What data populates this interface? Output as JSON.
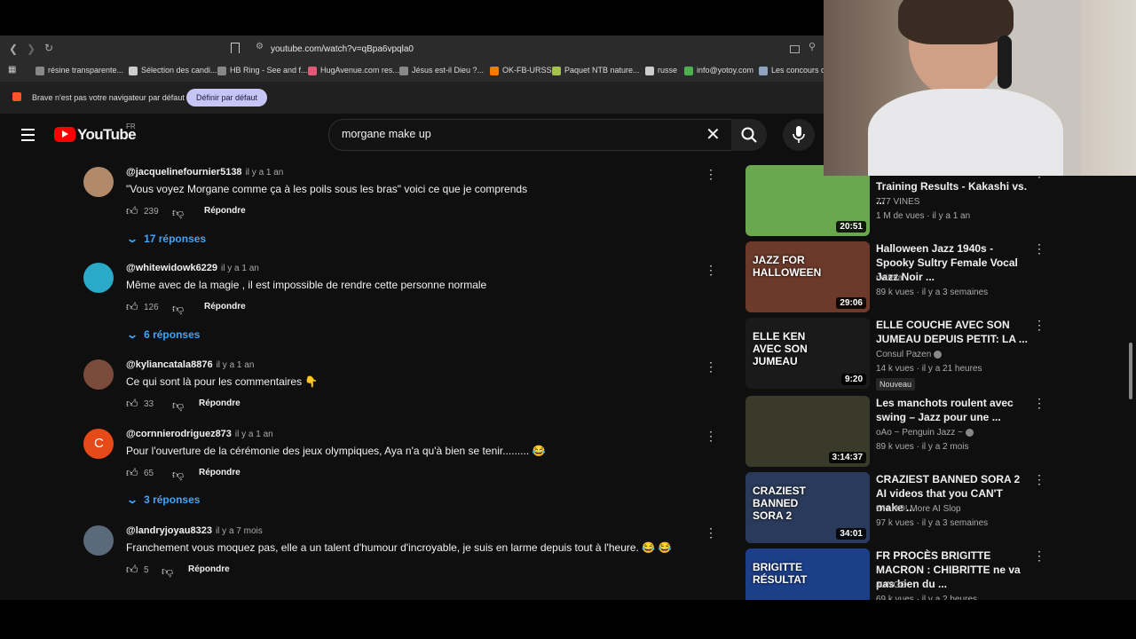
{
  "browser": {
    "url": "youtube.com/watch?v=qBpa6vpqla0",
    "bookmarks": [
      {
        "label": "résine transparente...",
        "color": "#888888"
      },
      {
        "label": "Sélection des candi...",
        "color": "#cccccc"
      },
      {
        "label": "HB Ring - See and f...",
        "color": "#888888"
      },
      {
        "label": "HugAvenue.com res...",
        "color": "#e05b7a"
      },
      {
        "label": "Jésus est-il Dieu ?...",
        "color": "#888888"
      },
      {
        "label": "OK-FB-URSS",
        "color": "#f57c00"
      },
      {
        "label": "Paquet NTB nature...",
        "color": "#a5c24b"
      },
      {
        "label": "russe",
        "color": "#cccccc"
      },
      {
        "label": "info@yotoy.com",
        "color": "#4caf50"
      },
      {
        "label": "Les concours d'a",
        "color": "#90a4c0"
      }
    ],
    "infobar_text": "Brave n'est pas votre navigateur par défaut",
    "infobar_button": "Définir par défaut"
  },
  "youtube": {
    "logo_text": "YouTube",
    "region": "FR",
    "search_query": "morgane make up"
  },
  "comments": [
    {
      "user": "@jacquelinefournier5138",
      "time": "il y a 1 an",
      "text": "\"Vous voyez Morgane comme ça à les poils sous les bras\" voici ce que je comprends",
      "likes": "239",
      "reply_label": "Répondre",
      "replies": "17 réponses",
      "avatar_color": "#b08a6a"
    },
    {
      "user": "@whitewidowk6229",
      "time": "il y a 1 an",
      "text": "Même avec de la magie , il est impossible de rendre cette personne normale",
      "likes": "126",
      "reply_label": "Répondre",
      "replies": "6 réponses",
      "avatar_color": "#2aa9c9"
    },
    {
      "user": "@kyliancatala8876",
      "time": "il y a 1 an",
      "text": "Ce qui sont là pour les commentaires 👇",
      "likes": "33",
      "reply_label": "Répondre",
      "replies": "",
      "avatar_color": "#7a4a3a"
    },
    {
      "user": "@cornnierodriguez873",
      "time": "il y a 1 an",
      "text": "Pour l'ouverture de la cérémonie des jeux olympiques, Aya n'a qu'à bien se tenir......... 😂",
      "likes": "65",
      "reply_label": "Répondre",
      "replies": "3 réponses",
      "avatar_color": "#e64a19",
      "avatar_letter": "C"
    },
    {
      "user": "@landryjoyau8323",
      "time": "il y a 7 mois",
      "text": "Franchement vous moquez pas, elle a un talent d'humour d'incroyable, je suis en larme depuis tout à l'heure. 😂 😂",
      "likes": "5",
      "reply_label": "Répondre",
      "replies": "",
      "avatar_color": "#5a6a7a"
    }
  ],
  "videos": [
    {
      "title": "Kakashi Evaluates Naruto's Training Results - Kakashi vs. ...",
      "channel": "777 VINES",
      "stats": "1 M de vues · il y a 1 an",
      "duration": "20:51",
      "thumb_color": "#6aa84f",
      "verified": false,
      "new": false
    },
    {
      "title": "Halloween Jazz 1940s - Spooky Sultry Female Vocal Jazz Noir ...",
      "channel": "noirela",
      "stats": "89 k vues · il y a 3 semaines",
      "duration": "29:06",
      "thumb_color": "#6b3a2a",
      "thumb_text": "JAZZ FOR HALLOWEEN",
      "verified": false,
      "new": false
    },
    {
      "title": "ELLE COUCHE AVEC SON JUMEAU DEPUIS PETIT: LA ...",
      "channel": "Consul Pazen",
      "stats": "14 k vues · il y a 21 heures",
      "duration": "9:20",
      "thumb_color": "#1a1a1a",
      "thumb_text": "ELLE KEN AVEC SON JUMEAU",
      "verified": true,
      "new": true,
      "new_label": "Nouveau"
    },
    {
      "title": "Les manchots roulent avec swing – Jazz pour une ...",
      "channel": "oAo ~ Penguin Jazz ~",
      "stats": "89 k vues · il y a 2 mois",
      "duration": "3:14:37",
      "thumb_color": "#3a3a2a",
      "verified": true,
      "new": false
    },
    {
      "title": "CRAZIEST BANNED SORA 2 AI videos that you CAN'T make ...",
      "channel": "OH NO! More AI Slop",
      "stats": "97 k vues · il y a 3 semaines",
      "duration": "34:01",
      "thumb_color": "#2a3a5a",
      "thumb_text": "CRAZIEST BANNED SORA 2",
      "verified": false,
      "new": false
    },
    {
      "title": "FR PROCÈS BRIGITTE MACRON : CHIBRITTE ne va pas bien du ...",
      "channel": "JUNGO",
      "stats": "69 k vues · il y a 2 heures",
      "duration": "",
      "thumb_color": "#1c3f8a",
      "thumb_text": "BRIGITTE RÉSULTAT",
      "verified": false,
      "new": false
    }
  ]
}
